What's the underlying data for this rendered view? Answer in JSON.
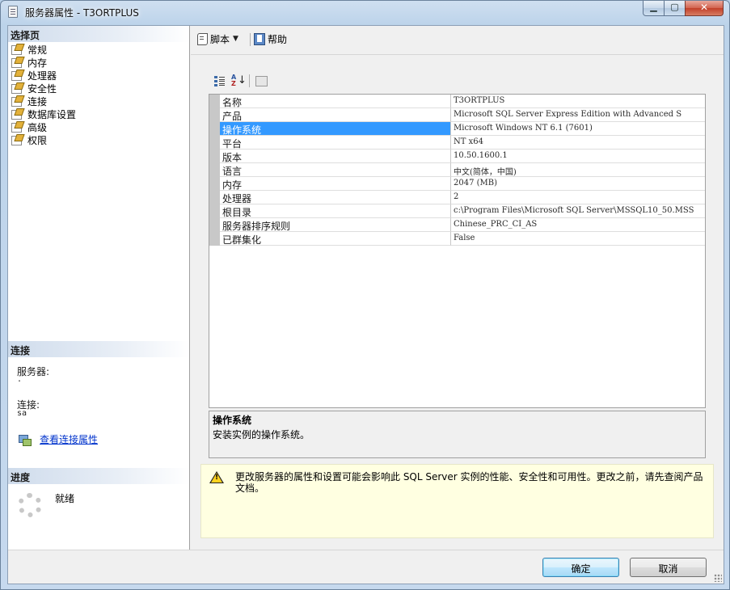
{
  "window": {
    "title": "服务器属性 - T3ORTPLUS",
    "minimize": "0",
    "maximize": "1",
    "close": "r"
  },
  "left_panel": {
    "select_page_header": "选择页",
    "pages": [
      {
        "label": "常规"
      },
      {
        "label": "内存"
      },
      {
        "label": "处理器"
      },
      {
        "label": "安全性"
      },
      {
        "label": "连接"
      },
      {
        "label": "数据库设置"
      },
      {
        "label": "高级"
      },
      {
        "label": "权限"
      }
    ],
    "connection": {
      "header": "连接",
      "server_label": "服务器:",
      "server_value": ".",
      "connection_label": "连接:",
      "connection_value": "sa",
      "view_link": "查看连接属性"
    },
    "progress": {
      "header": "进度",
      "status": "就绪"
    }
  },
  "toolbar": {
    "script_label": "脚本",
    "help_label": "帮助"
  },
  "property_grid": {
    "selected_row": "操作系统",
    "rows": [
      {
        "name": "名称",
        "value": "T3ORTPLUS"
      },
      {
        "name": "产品",
        "value": "Microsoft SQL Server Express Edition with Advanced S"
      },
      {
        "name": "操作系统",
        "value": "Microsoft Windows NT 6.1 (7601)"
      },
      {
        "name": "平台",
        "value": "NT x64"
      },
      {
        "name": "版本",
        "value": "10.50.1600.1"
      },
      {
        "name": "语言",
        "value": "中文(简体，中国)"
      },
      {
        "name": "内存",
        "value": "2047 (MB)"
      },
      {
        "name": "处理器",
        "value": "2"
      },
      {
        "name": "根目录",
        "value": "c:\\Program Files\\Microsoft SQL Server\\MSSQL10_50.MSS"
      },
      {
        "name": "服务器排序规则",
        "value": "Chinese_PRC_CI_AS"
      },
      {
        "name": "已群集化",
        "value": "False"
      }
    ]
  },
  "description": {
    "title": "操作系统",
    "text": "安装实例的操作系统。"
  },
  "warning": {
    "text": "更改服务器的属性和设置可能会影响此 SQL Server 实例的性能、安全性和可用性。更改之前，请先查阅产品文档。"
  },
  "buttons": {
    "ok": "确定",
    "cancel": "取消"
  }
}
